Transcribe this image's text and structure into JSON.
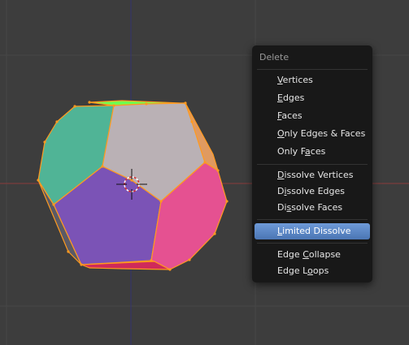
{
  "menu": {
    "title": "Delete",
    "items": [
      {
        "pre": "",
        "key": "V",
        "post": "ertices"
      },
      {
        "pre": "",
        "key": "E",
        "post": "dges"
      },
      {
        "pre": "",
        "key": "F",
        "post": "aces"
      },
      {
        "pre": "",
        "key": "O",
        "post": "nly Edges & Faces"
      },
      {
        "pre": "Only F",
        "key": "a",
        "post": "ces"
      },
      {
        "pre": "",
        "key": "D",
        "post": "issolve Vertices"
      },
      {
        "pre": "D",
        "key": "i",
        "post": "ssolve Edges"
      },
      {
        "pre": "Di",
        "key": "s",
        "post": "solve Faces"
      },
      {
        "pre": "",
        "key": "L",
        "post": "imited Dissolve"
      },
      {
        "pre": "Edge ",
        "key": "C",
        "post": "ollapse"
      },
      {
        "pre": "Edge L",
        "key": "o",
        "post": "ops"
      }
    ],
    "active_item": "Limited Dissolve"
  },
  "scene": {
    "background": "#3d3d3d",
    "axis_x_color": "#8a3a3a",
    "axis_y_color": "#34346e",
    "edge_color": "#ff9a1f",
    "faces": {
      "top_left": "#50b496",
      "top_middle": "#bab1b5",
      "middle": "#7b53b6",
      "right": "#e55191",
      "top_edge_strip": "#70ff50",
      "bottom_strip": "#d02a5a",
      "left_strip": "#5a5a66"
    }
  }
}
